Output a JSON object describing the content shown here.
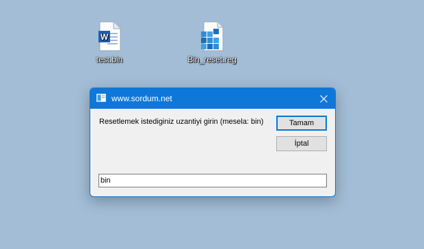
{
  "desktop": {
    "icons": [
      {
        "name": "test.bin",
        "icon": "word-document-icon"
      },
      {
        "name": "Bin_reset.reg",
        "icon": "registry-file-icon"
      }
    ]
  },
  "dialog": {
    "title": "www.sordum.net",
    "prompt": "Resetlemek istediginiz uzantiyi girin (mesela: bin)",
    "ok_label": "Tamam",
    "cancel_label": "İptal",
    "input_value": "bin",
    "accent_color": "#0e78d8"
  }
}
